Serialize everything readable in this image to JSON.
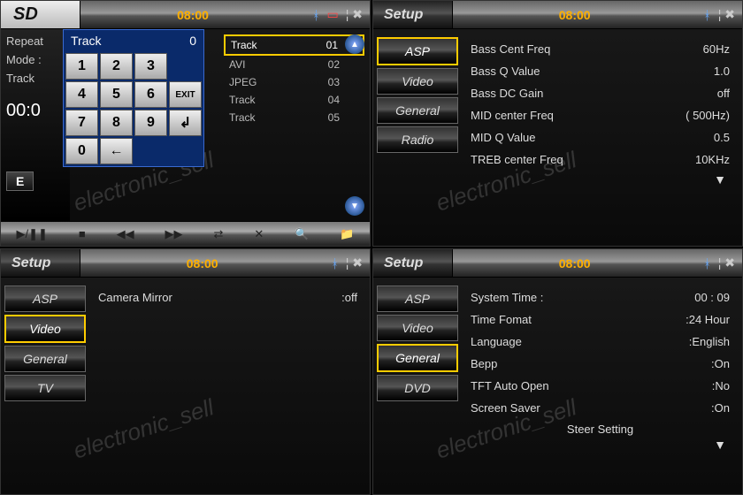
{
  "watermark": "electronic_sell",
  "sd": {
    "title": "SD",
    "clock": "08:00",
    "left": {
      "repeat": "Repeat",
      "mode": "Mode :",
      "track": "Track",
      "time": "00:0"
    },
    "keypad": {
      "head_label": "Track",
      "head_value": "0",
      "keys": [
        "1",
        "2",
        "3",
        "",
        "4",
        "5",
        "6",
        "EXIT",
        "7",
        "8",
        "9",
        "↲",
        "0",
        "←",
        "",
        ""
      ]
    },
    "tracks": [
      {
        "name": "Track",
        "num": "01",
        "sel": true
      },
      {
        "name": "AVI",
        "num": "02",
        "sel": false
      },
      {
        "name": "JPEG",
        "num": "03",
        "sel": false
      },
      {
        "name": "Track",
        "num": "04",
        "sel": false
      },
      {
        "name": "Track",
        "num": "05",
        "sel": false
      }
    ],
    "e_label": "E",
    "playbar": [
      "▶/❚❚",
      "■",
      "◀◀",
      "▶▶",
      "⇄",
      "✕",
      "🔍",
      "📁"
    ]
  },
  "asp": {
    "title": "Setup",
    "clock": "08:00",
    "menu": [
      "ASP",
      "Video",
      "General",
      "Radio"
    ],
    "selected": 0,
    "settings": [
      {
        "lab": "Bass Cent Freq",
        "val": "60Hz"
      },
      {
        "lab": "Bass Q Value",
        "val": "1.0"
      },
      {
        "lab": "Bass DC Gain",
        "val": "off"
      },
      {
        "lab": "MID center Freq",
        "val": "( 500Hz)"
      },
      {
        "lab": "MID  Q  Value",
        "val": "0.5"
      },
      {
        "lab": "TREB center Freq",
        "val": "10KHz"
      }
    ]
  },
  "video": {
    "title": "Setup",
    "clock": "08:00",
    "menu": [
      "ASP",
      "Video",
      "General",
      "TV"
    ],
    "selected": 1,
    "settings": [
      {
        "lab": "Camera Mirror",
        "val": ":off"
      }
    ]
  },
  "general": {
    "title": "Setup",
    "clock": "08:00",
    "menu": [
      "ASP",
      "Video",
      "General",
      "DVD"
    ],
    "selected": 2,
    "settings": [
      {
        "lab": "System Time  :",
        "val": "00 : 09"
      },
      {
        "lab": "Time Fomat",
        "val": ":24 Hour"
      },
      {
        "lab": "Language",
        "val": ":English"
      },
      {
        "lab": "Bepp",
        "val": ":On"
      },
      {
        "lab": "TFT Auto Open",
        "val": ":No"
      },
      {
        "lab": "Screen Saver",
        "val": ":On"
      }
    ],
    "steer": "Steer Setting"
  }
}
